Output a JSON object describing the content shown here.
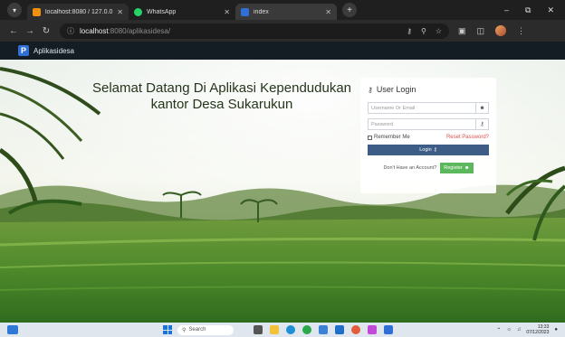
{
  "browser": {
    "tabs": [
      {
        "title": "localhost:8080 / 127.0.0.1 / des",
        "color": "#f29111"
      },
      {
        "title": "WhatsApp",
        "color": "#25d366"
      },
      {
        "title": "index",
        "color": "#2f6fd6"
      }
    ],
    "url_host": "localhost",
    "url_path": ":8080/aplikasidesa/"
  },
  "app": {
    "logo_letter": "P",
    "name": "Aplikasidesa"
  },
  "welcome": {
    "line1": "Selamat Datang Di Aplikasi Kependudukan",
    "line2": "kantor Desa Sukarukun"
  },
  "login": {
    "title": "User Login",
    "username_placeholder": "Username Or Email",
    "password_placeholder": "Password",
    "remember_label": "Remember Me",
    "reset_label": "Reset Password?",
    "login_button": "Login",
    "no_account_text": "Don't Have an Account?",
    "register_button": "Register"
  },
  "taskbar": {
    "search_label": "Search",
    "time": "13:33",
    "date": "07/12/2023"
  },
  "colors": {
    "login_button": "#3d5d86",
    "register_button": "#5cb85c",
    "reset_link": "#d9534f"
  }
}
